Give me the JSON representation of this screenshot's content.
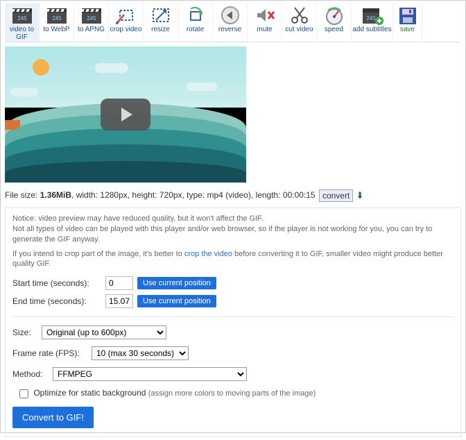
{
  "toolbar": [
    {
      "label": "video to GIF"
    },
    {
      "label": "to WebP"
    },
    {
      "label": "to APNG"
    },
    {
      "label": "crop video"
    },
    {
      "label": "resize"
    },
    {
      "label": "rotate"
    },
    {
      "label": "reverse"
    },
    {
      "label": "mute"
    },
    {
      "label": "cut video"
    },
    {
      "label": "speed"
    },
    {
      "label": "add subtitles"
    },
    {
      "label": "save"
    }
  ],
  "info": {
    "filesize_label": "File size: ",
    "filesize_value": "1.36MiB",
    "rest": ", width: 1280px, height: 720px, type: mp4 (video), length: 00:00:15",
    "convert": "convert"
  },
  "notices": {
    "n1": "Notice: video preview may have reduced quality, but it won't affect the GIF.\nNot all types of video can be played with this player and/or web browser, so if the player is not working for you, you can try to generate the GIF anyway.",
    "n2a": "If you intend to crop part of the image, it's better to ",
    "n2link": "crop the video",
    "n2b": " before converting it to GIF, smaller video might produce better quality GIF."
  },
  "fields": {
    "start_label": "Start time (seconds):",
    "start_value": "0",
    "end_label": "End time (seconds):",
    "end_value": "15.07",
    "use_current": "Use current position",
    "size_label": "Size:",
    "size_value": "Original (up to 600px)",
    "fps_label": "Frame rate (FPS):",
    "fps_value": "10 (max 30 seconds)",
    "method_label": "Method:",
    "method_value": "FFMPEG",
    "optimize_label": "Optimize for static background",
    "optimize_sub": "(assign more colors to moving parts of the image)"
  },
  "main_button": "Convert to GIF!"
}
